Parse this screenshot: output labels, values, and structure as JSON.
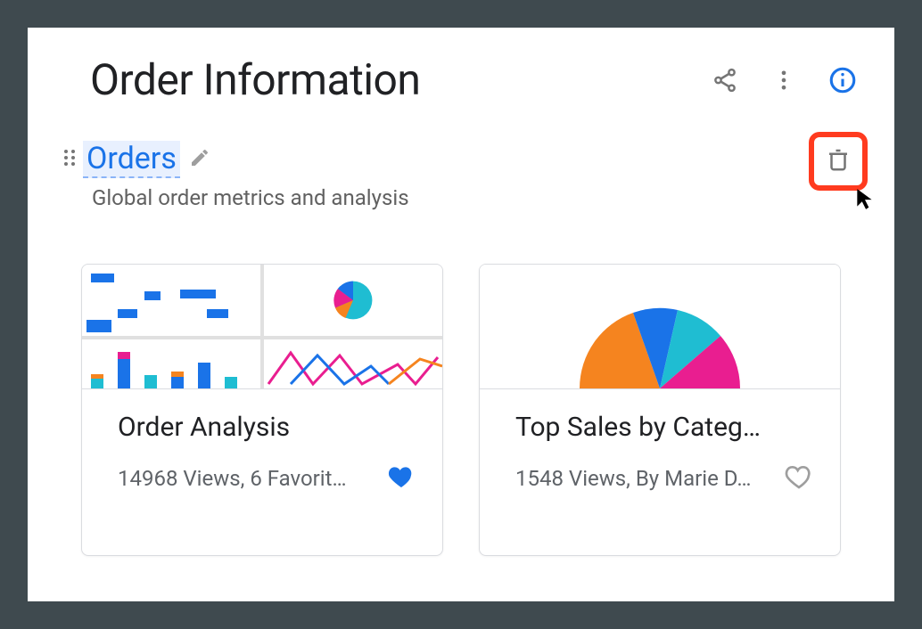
{
  "header": {
    "title": "Order Information"
  },
  "section": {
    "title": "Orders",
    "description": "Global order metrics and analysis"
  },
  "cards": [
    {
      "title": "Order Analysis",
      "meta": "14968 Views, 6 Favorit…",
      "favorited": true
    },
    {
      "title": "Top Sales by Categ…",
      "meta": "1548 Views, By Marie D…",
      "favorited": false
    }
  ],
  "colors": {
    "accent": "#1a73e8",
    "highlight": "#ff3b1f",
    "pink": "#e91e90",
    "orange": "#f5841f",
    "teal": "#1fbdd2"
  }
}
